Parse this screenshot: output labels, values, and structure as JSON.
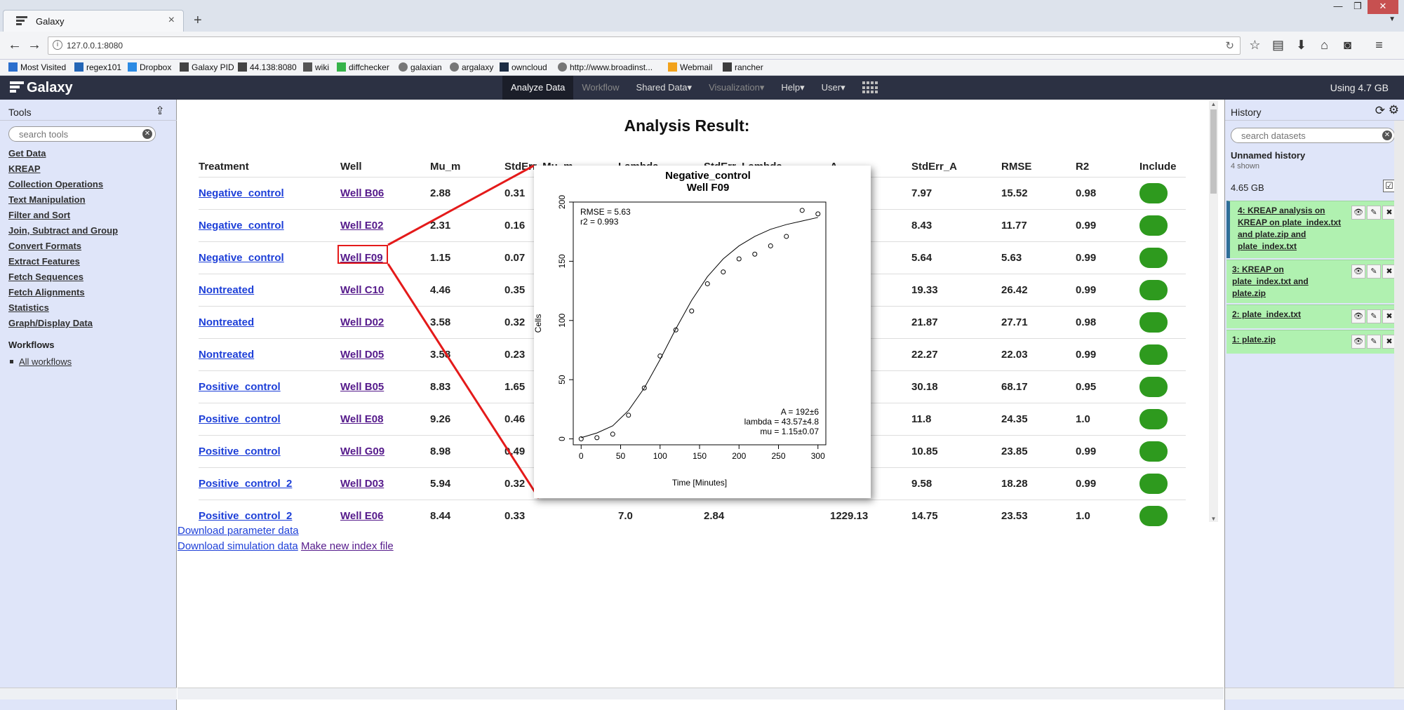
{
  "browser": {
    "tab_title": "Galaxy",
    "tab_close": "×",
    "new_tab": "+",
    "url": "127.0.0.1:8080",
    "bookmarks": [
      "Most Visited",
      "regex101",
      "Dropbox",
      "Galaxy PID",
      "44.138:8080",
      "wiki",
      "diffchecker",
      "galaxian",
      "argalaxy",
      "owncloud",
      "http://www.broadinst...",
      "Webmail",
      "rancher"
    ]
  },
  "masthead": {
    "brand": "Galaxy",
    "nav": [
      {
        "label": "Analyze Data",
        "state": "active"
      },
      {
        "label": "Workflow",
        "state": "disabled"
      },
      {
        "label": "Shared Data▾",
        "state": "normal"
      },
      {
        "label": "Visualization▾",
        "state": "disabled"
      },
      {
        "label": "Help▾",
        "state": "normal"
      },
      {
        "label": "User▾",
        "state": "normal"
      }
    ],
    "quota": "Using 4.7 GB"
  },
  "tools": {
    "title": "Tools",
    "search_placeholder": "search tools",
    "sections": [
      "Get Data",
      "KREAP",
      "Collection Operations",
      "Text Manipulation",
      "Filter and Sort",
      "Join, Subtract and Group",
      "Convert Formats",
      "Extract Features",
      "Fetch Sequences",
      "Fetch Alignments",
      "Statistics",
      "Graph/Display Data"
    ],
    "workflows_title": "Workflows",
    "workflows_link": "All workflows"
  },
  "result": {
    "title": "Analysis Result:",
    "columns": [
      "Treatment",
      "Well",
      "Mu_m",
      "StdErr_Mu_m",
      "Lambda",
      "StdErr_Lambda",
      "A",
      "StdErr_A",
      "RMSE",
      "R2",
      "Include"
    ],
    "rows": [
      [
        "Negative_control",
        "Well B06",
        "2.88",
        "0.31",
        "",
        "",
        "",
        "7.97",
        "15.52",
        "0.98"
      ],
      [
        "Negative_control",
        "Well E02",
        "2.31",
        "0.16",
        "",
        "",
        "",
        "8.43",
        "11.77",
        "0.99"
      ],
      [
        "Negative_control",
        "Well F09",
        "1.15",
        "0.07",
        "",
        "",
        "",
        "5.64",
        "5.63",
        "0.99"
      ],
      [
        "Nontreated",
        "Well C10",
        "4.46",
        "0.35",
        "",
        "",
        "",
        "19.33",
        "26.42",
        "0.99"
      ],
      [
        "Nontreated",
        "Well D02",
        "3.58",
        "0.32",
        "",
        "",
        "",
        "21.87",
        "27.71",
        "0.98"
      ],
      [
        "Nontreated",
        "Well D05",
        "3.58",
        "0.23",
        "",
        "",
        "",
        "22.27",
        "22.03",
        "0.99"
      ],
      [
        "Positive_control",
        "Well B05",
        "8.83",
        "1.65",
        "",
        "",
        "",
        "30.18",
        "68.17",
        "0.95"
      ],
      [
        "Positive_control",
        "Well E08",
        "9.26",
        "0.46",
        "",
        "",
        "",
        "11.8",
        "24.35",
        "1.0"
      ],
      [
        "Positive_control",
        "Well G09",
        "8.98",
        "0.49",
        "",
        "",
        "",
        "10.85",
        "23.85",
        "0.99"
      ],
      [
        "Positive_control_2",
        "Well D03",
        "5.94",
        "0.32",
        "",
        "",
        "",
        "9.58",
        "18.28",
        "0.99"
      ],
      [
        "Positive_control_2",
        "Well E06",
        "8.44",
        "0.33",
        "7.0",
        "2.84",
        "1229.13",
        "14.75",
        "23.53",
        "1.0"
      ]
    ],
    "download_param": "Download parameter data",
    "download_sim": "Download simulation data",
    "make_index": "Make new index file"
  },
  "popup": {
    "title_line1": "Negative_control",
    "title_line2": "Well F09",
    "rmse": "RMSE = 5.63",
    "r2": "r2 = 0.993",
    "a_stat": "A = 192±6",
    "lambda_stat": "lambda = 43.57±4.8",
    "mu_stat": "mu = 1.15±0.07"
  },
  "chart_data": {
    "type": "scatter",
    "title": "Negative_control\nWell F09",
    "xlabel": "Time [Minutes]",
    "ylabel": "Cells",
    "xlim": [
      -10,
      310
    ],
    "ylim": [
      -5,
      200
    ],
    "xticks": [
      0,
      50,
      100,
      150,
      200,
      250,
      300
    ],
    "yticks": [
      0,
      50,
      100,
      150,
      200
    ],
    "x": [
      0,
      20,
      40,
      60,
      80,
      100,
      120,
      140,
      160,
      180,
      200,
      220,
      240,
      260,
      280,
      300
    ],
    "y": [
      0,
      1,
      4,
      20,
      43,
      70,
      92,
      108,
      131,
      141,
      152,
      156,
      163,
      171,
      193,
      190
    ],
    "fit_x": [
      0,
      20,
      40,
      60,
      80,
      100,
      120,
      140,
      160,
      180,
      200,
      220,
      240,
      260,
      280,
      300
    ],
    "fit_y": [
      1,
      5,
      11,
      24,
      43,
      67,
      93,
      117,
      137,
      152,
      163,
      171,
      177,
      181,
      184,
      187
    ],
    "annotations": [
      "RMSE = 5.63",
      "r2 = 0.993",
      "A = 192±6",
      "lambda = 43.57±4.8",
      "mu = 1.15±0.07"
    ]
  },
  "history": {
    "title": "History",
    "search_placeholder": "search datasets",
    "name": "Unnamed history",
    "shown": "4 shown",
    "size": "4.65 GB",
    "datasets": [
      {
        "title": "4: KREAP analysis on KREAP on plate_index.txt and plate.zip and plate_index.txt",
        "selected": true
      },
      {
        "title": "3: KREAP on plate_index.txt and plate.zip",
        "selected": false
      },
      {
        "title": "2: plate_index.txt",
        "selected": false
      },
      {
        "title": "1: plate.zip",
        "selected": false
      }
    ]
  }
}
